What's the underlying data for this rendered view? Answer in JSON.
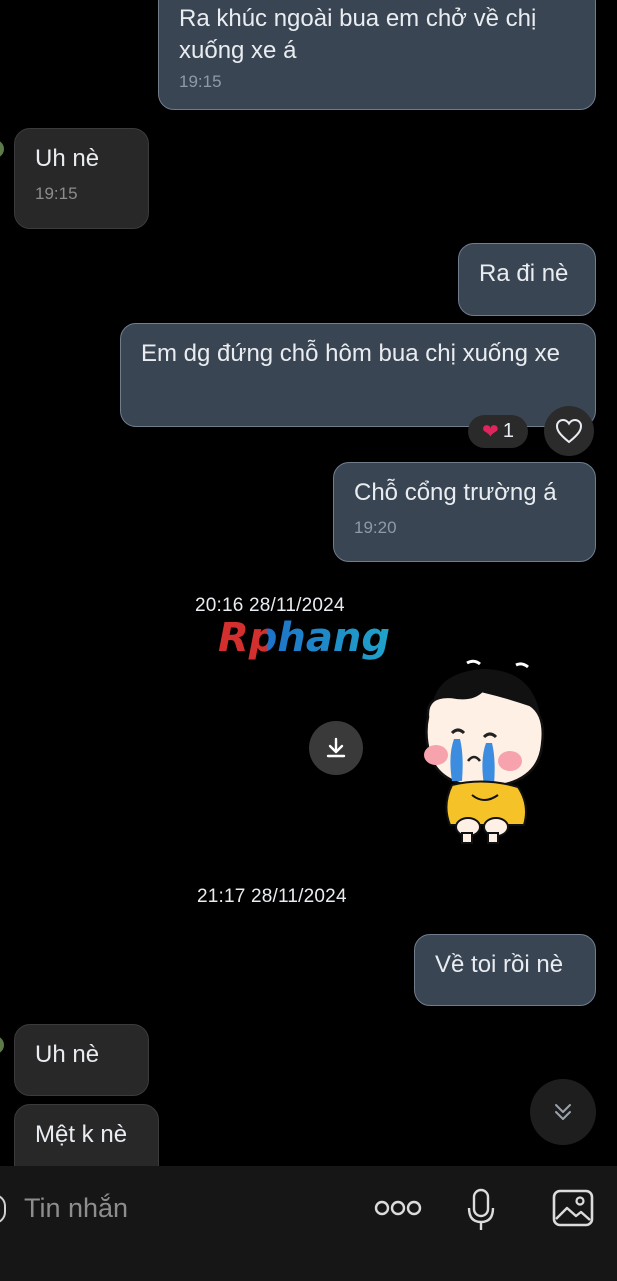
{
  "messages": [
    {
      "id": "m1",
      "dir": "out",
      "text": "Ra khúc ngoài bua em chở về chị xuống xe á",
      "time": "19:15"
    },
    {
      "id": "m2",
      "dir": "in",
      "text": "Uh nè",
      "time": "19:15"
    },
    {
      "id": "m3",
      "dir": "out",
      "text": "Ra đi nè",
      "time": ""
    },
    {
      "id": "m4",
      "dir": "out",
      "text": "Em dg đứng chỗ hôm bua chị xuống xe",
      "time": "",
      "reaction": {
        "emoji": "❤️",
        "count": "1"
      }
    },
    {
      "id": "m5",
      "dir": "out",
      "text": "Chỗ cổng trường á",
      "time": "19:20"
    },
    {
      "id": "m6",
      "dir": "out",
      "text": "Về toi rồi nè",
      "time": ""
    },
    {
      "id": "m7",
      "dir": "in",
      "text": "Uh nè",
      "time": ""
    },
    {
      "id": "m8",
      "dir": "in",
      "text": "Mệt k nè",
      "time": ""
    }
  ],
  "date_stamps": [
    "20:16 28/11/2024",
    "21:17 28/11/2024"
  ],
  "watermark": "Rphang",
  "composer": {
    "placeholder": "Tin nhắn"
  },
  "icons": {
    "reaction_add": "heart-outline-icon",
    "download": "download-icon",
    "scroll_down": "double-chevron-down-icon",
    "more": "more-dots-icon",
    "mic": "microphone-icon",
    "image": "image-icon"
  },
  "colors": {
    "outgoing_bubble": "#3a4553",
    "incoming_bubble": "#282828",
    "background": "#000000"
  }
}
